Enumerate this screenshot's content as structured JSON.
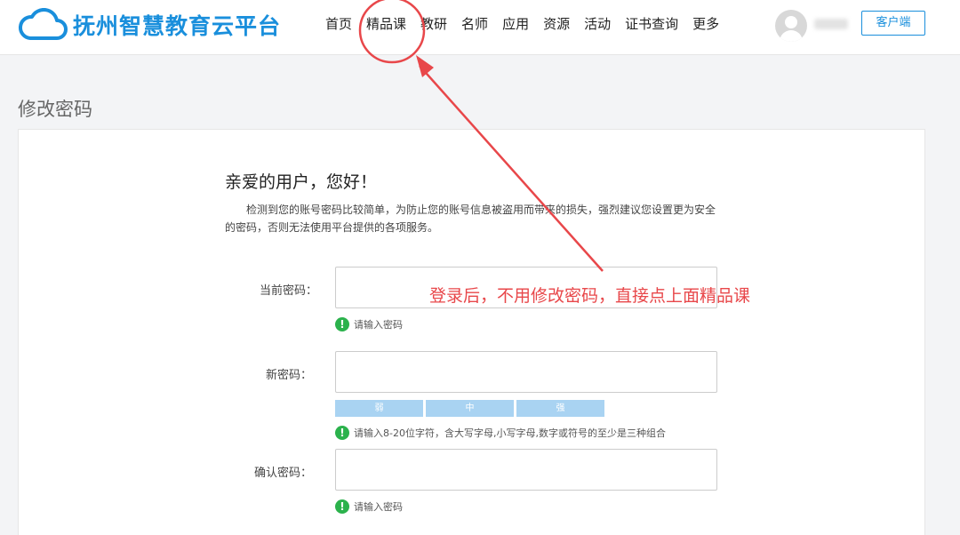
{
  "header": {
    "logo_text": "抚州智慧教育云平台",
    "nav": [
      "首页",
      "精品课",
      "教研",
      "名师",
      "应用",
      "资源",
      "活动",
      "证书查询",
      "更多"
    ],
    "client_button": "客户端"
  },
  "page": {
    "title": "修改密码",
    "greeting": "亲爱的用户，您好！",
    "notice": "检测到您的账号密码比较简单，为防止您的账号信息被盗用而带来的损失，强烈建议您设置更为安全的密码，否则无法使用平台提供的各项服务。"
  },
  "form": {
    "current_password": {
      "label": "当前密码：",
      "hint": "请输入密码"
    },
    "new_password": {
      "label": "新密码：",
      "strength": [
        "弱",
        "中",
        "强"
      ],
      "hint": "请输入8-20位字符，含大写字母,小写字母,数字或符号的至少是三种组合"
    },
    "confirm_password": {
      "label": "确认密码：",
      "hint": "请输入密码"
    }
  },
  "annotation": {
    "text": "登录后，不用修改密码，直接点上面精品课",
    "color": "#e8474a"
  },
  "colors": {
    "brand": "#1a8fdc",
    "success": "#2bb24c",
    "strength_bar": "#a9d3f2"
  }
}
